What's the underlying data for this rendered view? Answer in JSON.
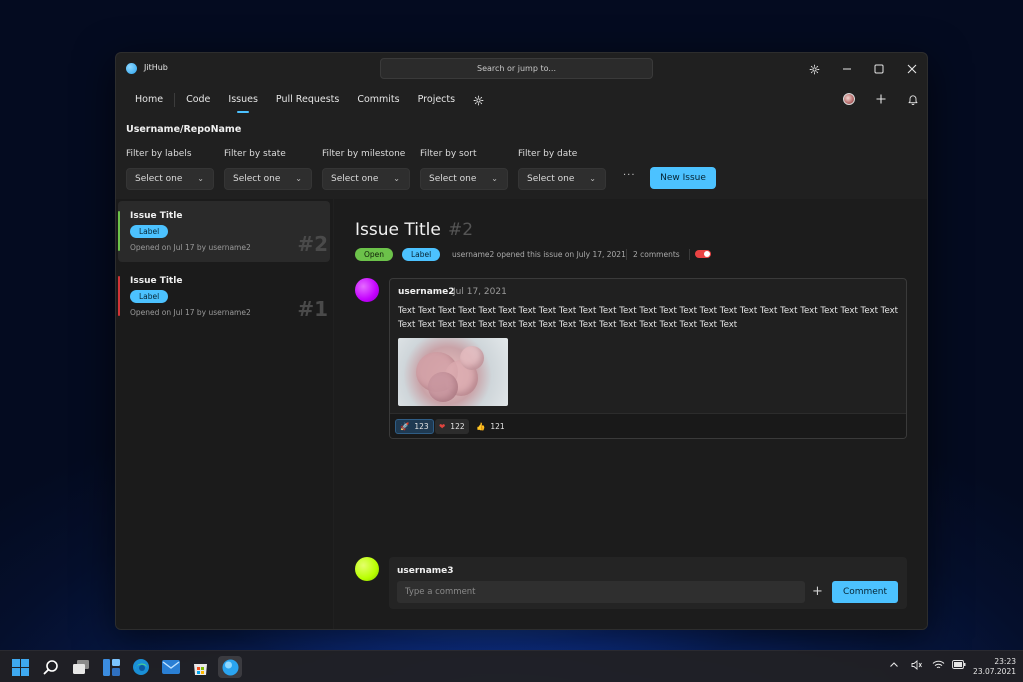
{
  "app": {
    "title": "JitHub",
    "search_placeholder": "Search or jump to..."
  },
  "titlebar_buttons": [
    "gear-icon",
    "minimize-icon",
    "maximize-icon",
    "close-icon"
  ],
  "nav": {
    "items": [
      {
        "label": "Home",
        "active": false
      },
      {
        "label": "Code",
        "active": false
      },
      {
        "label": "Issues",
        "active": true
      },
      {
        "label": "Pull Requests",
        "active": false
      },
      {
        "label": "Commits",
        "active": false
      },
      {
        "label": "Projects",
        "active": false
      }
    ],
    "settings_icon": "gear-icon",
    "right_icons": [
      "avatar",
      "plus-icon",
      "bell-icon"
    ]
  },
  "repo": {
    "name": "Username/RepoName"
  },
  "filters": [
    {
      "label": "Filter by labels",
      "value": "Select one"
    },
    {
      "label": "Filter by state",
      "value": "Select one"
    },
    {
      "label": "Filter by milestone",
      "value": "Select one"
    },
    {
      "label": "Filter by sort",
      "value": "Select one"
    },
    {
      "label": "Filter by date",
      "value": "Select one"
    }
  ],
  "more_label": "···",
  "new_issue_label": "New Issue",
  "issues": [
    {
      "title": "Issue Title",
      "label": "Label",
      "meta": "Opened on Jul 17 by username2",
      "number": "#2",
      "status_color": "#6cc24a",
      "selected": true
    },
    {
      "title": "Issue Title",
      "label": "Label",
      "meta": "Opened on Jul 17 by username2",
      "number": "#1",
      "status_color": "#d13438",
      "selected": false
    }
  ],
  "detail": {
    "title": "Issue Title",
    "number": "#2",
    "state": "Open",
    "label": "Label",
    "opened_text": "username2 opened this issue on July 17, 2021",
    "comments_count": "2 comments",
    "comment": {
      "user": "username2",
      "date": "Jul 17, 2021",
      "body": "Text Text Text Text Text Text Text Text Text Text Text Text Text Text Text Text Text Text Text Text Text Text Text Text Text Text Text Text Text Text Text Text Text Text Text Text Text Text Text Text Text Text",
      "reactions": [
        {
          "icon": "rocket-icon",
          "glyph": "🚀",
          "count": "123",
          "active": true
        },
        {
          "icon": "heart-icon",
          "glyph": "❤",
          "count": "122",
          "active": false
        },
        {
          "icon": "thumbs-up-icon",
          "glyph": "👍",
          "count": "121",
          "active": false
        }
      ]
    },
    "new_comment": {
      "user": "username3",
      "placeholder": "Type a comment",
      "submit_label": "Comment"
    }
  },
  "colors": {
    "accent": "#4cc2ff",
    "open": "#6cc24a",
    "closed_bar": "#d13438",
    "avatar_user2": "#c400ff",
    "avatar_user3": "#b8ff00"
  },
  "taskbar": {
    "icons": [
      "windows-start-icon",
      "search-icon",
      "task-view-icon",
      "widgets-icon",
      "edge-icon",
      "mail-icon",
      "store-icon",
      "jithub-icon"
    ],
    "tray_icons": [
      "chevron-up-icon",
      "speaker-icon",
      "wifi-icon",
      "battery-icon"
    ],
    "time": "23:23",
    "date": "23.07.2021"
  }
}
